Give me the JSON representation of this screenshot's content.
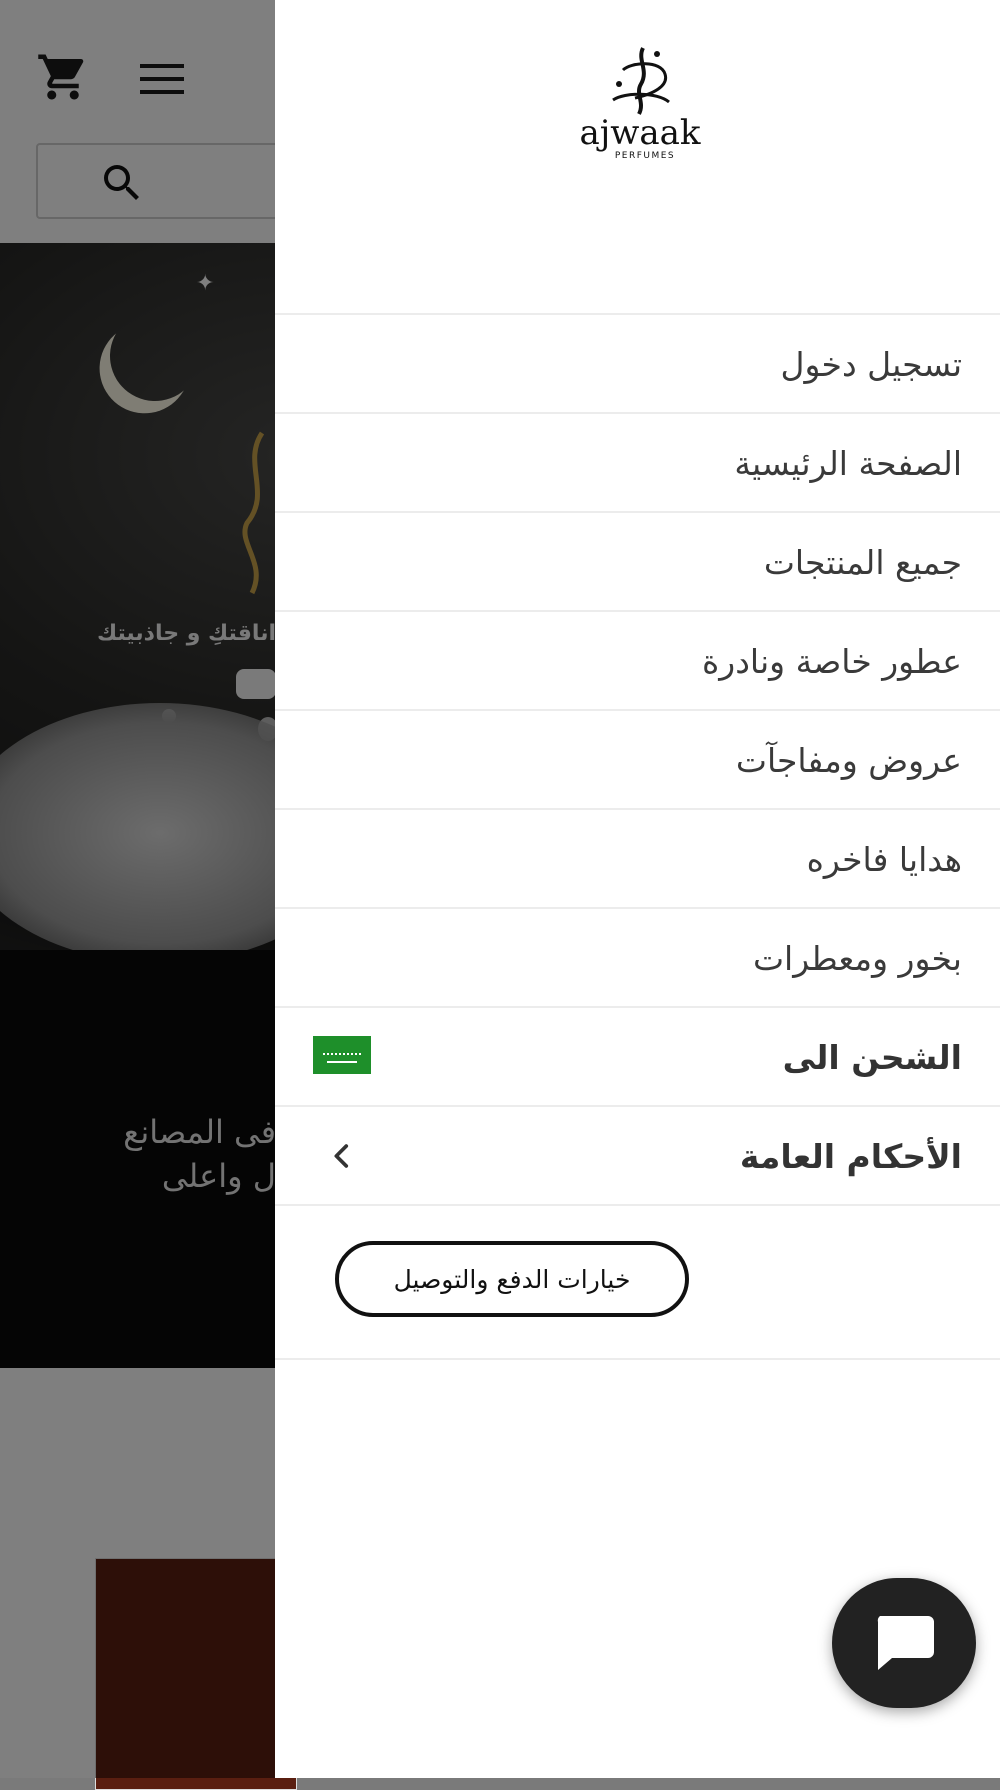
{
  "background_page": {
    "hero_tagline": "اناقتكِ و جاذبيتك",
    "band_text_line1": "فى المصانع",
    "band_text_line2": "ل واعلى"
  },
  "drawer": {
    "brand": {
      "wordmark": "ajwaak",
      "sub": "PERFUMES"
    },
    "menu_items": [
      {
        "label": "تسجيل دخول"
      },
      {
        "label": "الصفحة الرئيسية"
      },
      {
        "label": "جميع المنتجات"
      },
      {
        "label": "عطور خاصة ونادرة"
      },
      {
        "label": "عروض ومفاجآت"
      },
      {
        "label": "هدايا فاخره"
      },
      {
        "label": "بخور ومعطرات"
      },
      {
        "label": "الشحن الى",
        "trailing": "saudi-arabia-flag"
      },
      {
        "label": "الأحكام العامة",
        "trailing": "chevron-left-icon"
      }
    ],
    "payment_button_label": "خيارات الدفع والتوصيل"
  },
  "colors": {
    "overlay": "rgba(0,0,0,0.5)",
    "flag_green": "#1e8f2a",
    "chat_button": "#222222"
  }
}
